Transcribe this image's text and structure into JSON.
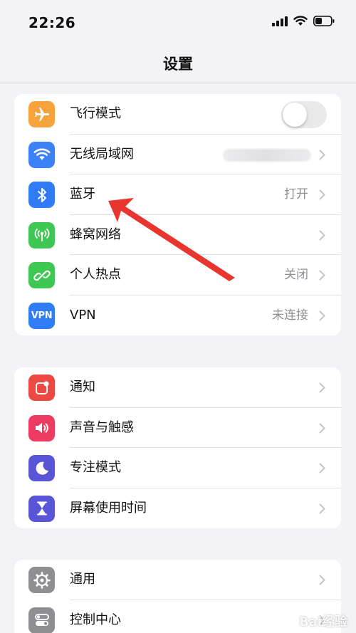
{
  "status_bar": {
    "time": "22:26"
  },
  "nav": {
    "title": "设置"
  },
  "groups": [
    {
      "items": [
        {
          "label": "飞行模式",
          "icon": "airplane-icon",
          "color": "#f7a23b",
          "control": "toggle",
          "toggle_on": false
        },
        {
          "label": "无线局域网",
          "icon": "wifi-icon",
          "color": "#3c82f6",
          "value": "",
          "value_blurred": true
        },
        {
          "label": "蓝牙",
          "icon": "bluetooth-icon",
          "color": "#2f7cf6",
          "value": "打开"
        },
        {
          "label": "蜂窝网络",
          "icon": "cellular-icon",
          "color": "#3fc754",
          "value": ""
        },
        {
          "label": "个人热点",
          "icon": "hotspot-icon",
          "color": "#3fc754",
          "value": "关闭"
        },
        {
          "label": "VPN",
          "icon": "vpn-icon",
          "icon_text": "VPN",
          "color": "#2f7cf6",
          "value": "未连接"
        }
      ]
    },
    {
      "items": [
        {
          "label": "通知",
          "icon": "notification-icon",
          "color": "#ee4842"
        },
        {
          "label": "声音与触感",
          "icon": "speaker-icon",
          "color": "#ee3b62"
        },
        {
          "label": "专注模式",
          "icon": "moon-icon",
          "color": "#5a55d6"
        },
        {
          "label": "屏幕使用时间",
          "icon": "hourglass-icon",
          "color": "#5a55d6"
        }
      ]
    },
    {
      "items": [
        {
          "label": "通用",
          "icon": "gear-icon",
          "color": "#8e8e93"
        },
        {
          "label": "控制中心",
          "icon": "control-center-icon",
          "color": "#8e8e93"
        }
      ]
    }
  ],
  "annotation": {
    "color": "#e8352e"
  },
  "watermark": {
    "text": "Bai经验"
  }
}
